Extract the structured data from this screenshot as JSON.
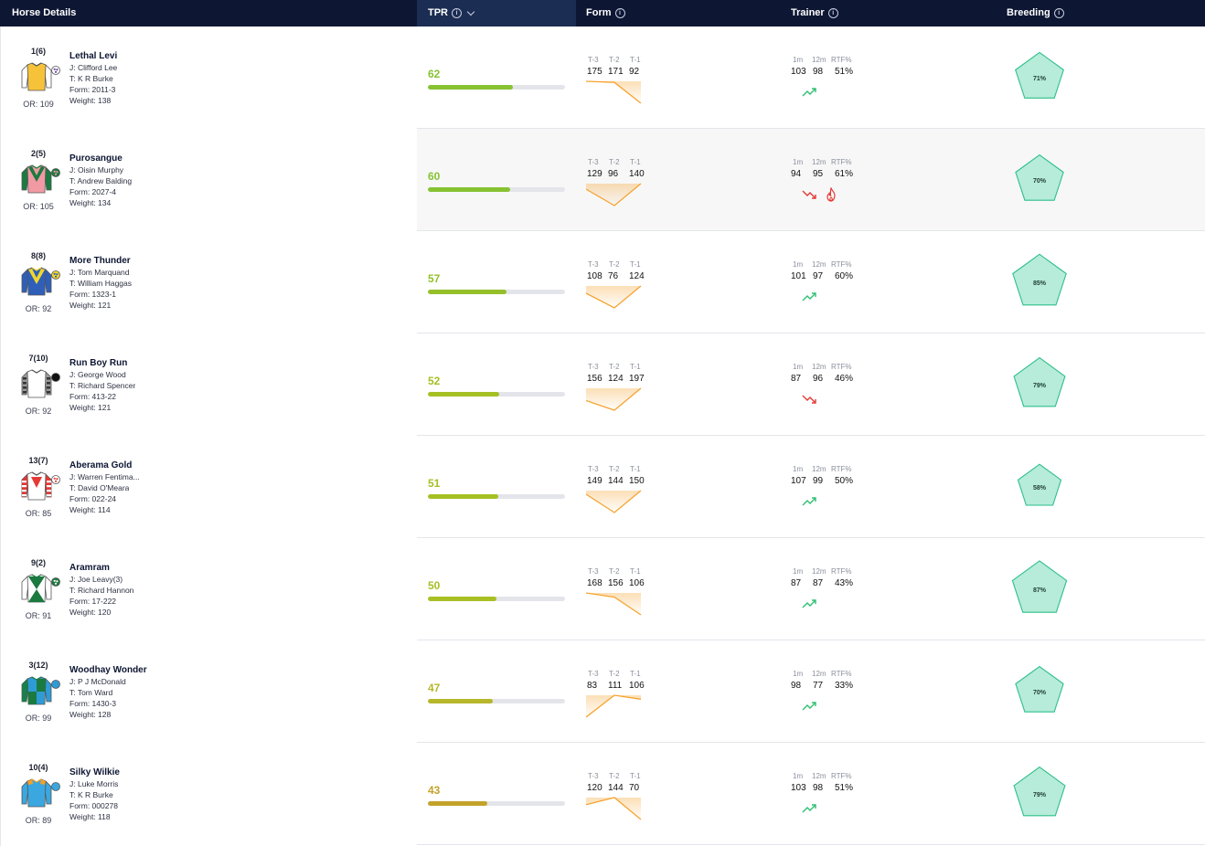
{
  "header": {
    "horse_details": "Horse Details",
    "tpr": "TPR",
    "form": "Form",
    "trainer": "Trainer",
    "breeding": "Breeding",
    "info_icon": "info-icon",
    "sort_icon": "chevron-down-icon"
  },
  "labels": {
    "t3": "T-3",
    "t2": "T-2",
    "t1": "T-1",
    "m1": "1m",
    "m12": "12m",
    "rtf": "RTF%"
  },
  "colors": {
    "header_bg": "#0d1633",
    "form_line": "#f7a330",
    "trend_up": "#2fbf71",
    "trend_down": "#e53935",
    "breeding_fill": "#b6ecd9",
    "breeding_stroke": "#2fbf8a"
  },
  "horses": [
    {
      "cloth": "1(6)",
      "name": "Lethal Levi",
      "jockey": "J: Clifford Lee",
      "trainer": "T: K R Burke",
      "form": "Form: 2011-3",
      "weight": "Weight: 138",
      "or": "OR: 109",
      "tpr": "62",
      "tpr_pct": 0.62,
      "tpr_color": "#86c232",
      "f3": "175",
      "f2": "171",
      "f1": "92",
      "m1": "103",
      "m12": "98",
      "rtf": "51%",
      "trend": "up",
      "hot": false,
      "breeding": "71%",
      "breeding_pct": 0.71,
      "silk": {
        "body": "#f6c23a",
        "sleeves": "#ffffff",
        "collar": "#f6c23a",
        "cap": "#ffffff",
        "capdots": "#6b3fa0",
        "pattern": "plain",
        "accent": "#f6c23a"
      }
    },
    {
      "cloth": "2(5)",
      "name": "Purosangue",
      "jockey": "J: Oisin Murphy",
      "trainer": "T: Andrew Balding",
      "form": "Form: 2027-4",
      "weight": "Weight: 134",
      "or": "OR: 105",
      "tpr": "60",
      "tpr_pct": 0.6,
      "tpr_color": "#86c232",
      "f3": "129",
      "f2": "96",
      "f1": "140",
      "m1": "94",
      "m12": "95",
      "rtf": "61%",
      "trend": "down",
      "hot": true,
      "breeding": "70%",
      "breeding_pct": 0.7,
      "silk": {
        "body": "#f29aa4",
        "sleeves": "#1b7a3f",
        "collar": "#1b7a3f",
        "cap": "#1b7a3f",
        "capdots": "#f29aa4",
        "pattern": "vee",
        "accent": "#1b7a3f"
      }
    },
    {
      "cloth": "8(8)",
      "name": "More Thunder",
      "jockey": "J: Tom Marquand",
      "trainer": "T: William Haggas",
      "form": "Form: 1323-1",
      "weight": "Weight: 121",
      "or": "OR: 92",
      "tpr": "57",
      "tpr_pct": 0.57,
      "tpr_color": "#95c02a",
      "f3": "108",
      "f2": "76",
      "f1": "124",
      "m1": "101",
      "m12": "97",
      "rtf": "60%",
      "trend": "up",
      "hot": false,
      "breeding": "85%",
      "breeding_pct": 0.85,
      "silk": {
        "body": "#2f5fb8",
        "sleeves": "#2f5fb8",
        "collar": "#f3d62a",
        "cap": "#f3d62a",
        "capdots": "#2f5fb8",
        "pattern": "vee",
        "accent": "#f3d62a"
      }
    },
    {
      "cloth": "7(10)",
      "name": "Run Boy Run",
      "jockey": "J: George Wood",
      "trainer": "T: Richard Spencer",
      "form": "Form: 413-22",
      "weight": "Weight: 121",
      "or": "OR: 92",
      "tpr": "52",
      "tpr_pct": 0.52,
      "tpr_color": "#a4c023",
      "f3": "156",
      "f2": "124",
      "f1": "197",
      "m1": "87",
      "m12": "96",
      "rtf": "46%",
      "trend": "down",
      "hot": false,
      "breeding": "79%",
      "breeding_pct": 0.79,
      "silk": {
        "body": "#ffffff",
        "sleeves": "#9a9a9a",
        "collar": "#ffffff",
        "cap": "#111111",
        "capdots": "#111111",
        "pattern": "plain",
        "accent": "#ffffff"
      }
    },
    {
      "cloth": "13(7)",
      "name": "Aberama Gold",
      "jockey": "J: Warren Fentima...",
      "trainer": "T: David O'Meara",
      "form": "Form: 022-24",
      "weight": "Weight: 114",
      "or": "OR: 85",
      "tpr": "51",
      "tpr_pct": 0.51,
      "tpr_color": "#a4c023",
      "f3": "149",
      "f2": "144",
      "f1": "150",
      "m1": "107",
      "m12": "99",
      "rtf": "50%",
      "trend": "up",
      "hot": false,
      "breeding": "58%",
      "breeding_pct": 0.58,
      "silk": {
        "body": "#ffffff",
        "sleeves": "#e53935",
        "collar": "#ffffff",
        "cap": "#ffffff",
        "capdots": "#e53935",
        "pattern": "triangle",
        "accent": "#e53935"
      }
    },
    {
      "cloth": "9(2)",
      "name": "Aramram",
      "jockey": "J: Joe Leavy(3)",
      "trainer": "T: Richard Hannon",
      "form": "Form: 17-222",
      "weight": "Weight: 120",
      "or": "OR: 91",
      "tpr": "50",
      "tpr_pct": 0.5,
      "tpr_color": "#a9bf24",
      "f3": "168",
      "f2": "156",
      "f1": "106",
      "m1": "87",
      "m12": "87",
      "rtf": "43%",
      "trend": "up",
      "hot": false,
      "breeding": "87%",
      "breeding_pct": 0.87,
      "silk": {
        "body": "#ffffff",
        "sleeves": "#ffffff",
        "collar": "#1b7a3f",
        "cap": "#1b7a3f",
        "capdots": "#ffffff",
        "pattern": "hourglass",
        "accent": "#1b7a3f"
      }
    },
    {
      "cloth": "3(12)",
      "name": "Woodhay Wonder",
      "jockey": "J: P J McDonald",
      "trainer": "T: Tom Ward",
      "form": "Form: 1430-3",
      "weight": "Weight: 128",
      "or": "OR: 99",
      "tpr": "47",
      "tpr_pct": 0.47,
      "tpr_color": "#b6b72a",
      "f3": "83",
      "f2": "111",
      "f1": "106",
      "m1": "98",
      "m12": "77",
      "rtf": "33%",
      "trend": "up",
      "hot": false,
      "breeding": "70%",
      "breeding_pct": 0.7,
      "silk": {
        "body": "#2f9bd6",
        "sleeves": "#2f9bd6",
        "collar": "#1b7a3f",
        "cap": "#2f9bd6",
        "capdots": "#2f9bd6",
        "pattern": "quarters",
        "accent": "#1b7a3f"
      }
    },
    {
      "cloth": "10(4)",
      "name": "Silky Wilkie",
      "jockey": "J: Luke Morris",
      "trainer": "T: K R Burke",
      "form": "Form: 000278",
      "weight": "Weight: 118",
      "or": "OR: 89",
      "tpr": "43",
      "tpr_pct": 0.43,
      "tpr_color": "#c3a32a",
      "f3": "120",
      "f2": "144",
      "f1": "70",
      "m1": "103",
      "m12": "98",
      "rtf": "51%",
      "trend": "up",
      "hot": false,
      "breeding": "79%",
      "breeding_pct": 0.79,
      "silk": {
        "body": "#3aa7e0",
        "sleeves": "#3aa7e0",
        "collar": "#f3a12a",
        "cap": "#3aa7e0",
        "capdots": "#3aa7e0",
        "pattern": "epaulets",
        "accent": "#f3a12a"
      }
    }
  ]
}
